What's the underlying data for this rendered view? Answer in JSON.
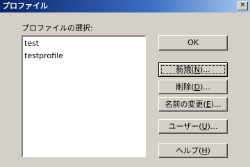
{
  "window": {
    "title": "プロファイル",
    "close_glyph": "✕"
  },
  "profile_list": {
    "label": "プロファイルの選択:",
    "items": [
      "test",
      "testprofile"
    ]
  },
  "buttons": {
    "ok": "OK",
    "new": {
      "text": "新規(",
      "key": "N",
      "suffix": ")..."
    },
    "delete": {
      "text": "削除(",
      "key": "D",
      "suffix": ")..."
    },
    "rename": {
      "text": "名前の変更(",
      "key": "E",
      "suffix": ")..."
    },
    "users": {
      "text": "ユーザー(",
      "key": "U",
      "suffix": ")..."
    },
    "help": {
      "text": "ヘルプ(",
      "key": "H",
      "suffix": ")"
    }
  }
}
